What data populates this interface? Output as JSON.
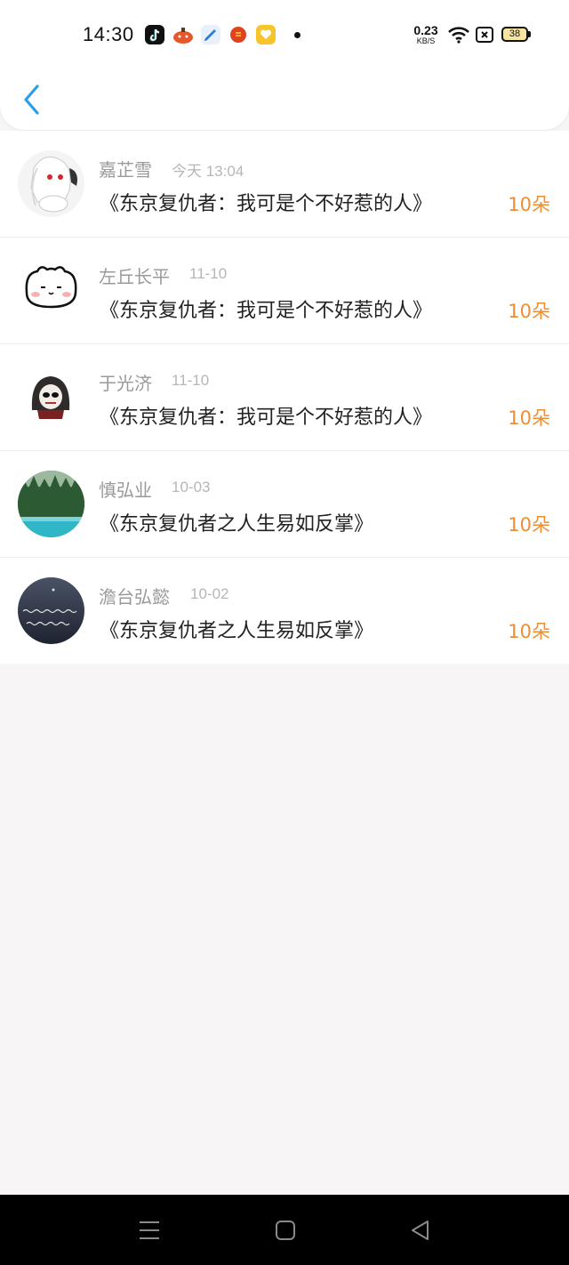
{
  "status_bar": {
    "time": "14:30",
    "net_speed_value": "0.23",
    "net_speed_unit": "KB/S",
    "battery": "38",
    "app_icons": [
      "tiktok-icon",
      "pumpkin-app-icon",
      "blue-bird-app-icon",
      "red-app-icon",
      "yellow-heart-app-icon"
    ]
  },
  "header": {
    "back_icon": "chevron-left-icon"
  },
  "list": {
    "items": [
      {
        "name": "嘉芷雪",
        "date": "今天 13:04",
        "title": "《东京复仇者：我可是个不好惹的人》",
        "amount": "10朵",
        "avatar": "anime-girl-avatar"
      },
      {
        "name": "左丘长平",
        "date": "11-10",
        "title": "《东京复仇者：我可是个不好惹的人》",
        "amount": "10朵",
        "avatar": "cartoon-cat-avatar"
      },
      {
        "name": "于光济",
        "date": "11-10",
        "title": "《东京复仇者：我可是个不好惹的人》",
        "amount": "10朵",
        "avatar": "hooded-skull-avatar"
      },
      {
        "name": "慎弘业",
        "date": "10-03",
        "title": "《东京复仇者之人生易如反掌》",
        "amount": "10朵",
        "avatar": "forest-lake-avatar"
      },
      {
        "name": "澹台弘懿",
        "date": "10-02",
        "title": "《东京复仇者之人生易如反掌》",
        "amount": "10朵",
        "avatar": "night-sea-text-avatar"
      }
    ]
  },
  "colors": {
    "accent_back": "#2a9fe6",
    "amount": "#ea8f36",
    "name": "#9a9a9a",
    "title": "#222222"
  },
  "navbar": {
    "icons": [
      "menu-icon",
      "home-square-icon",
      "back-triangle-icon"
    ]
  }
}
